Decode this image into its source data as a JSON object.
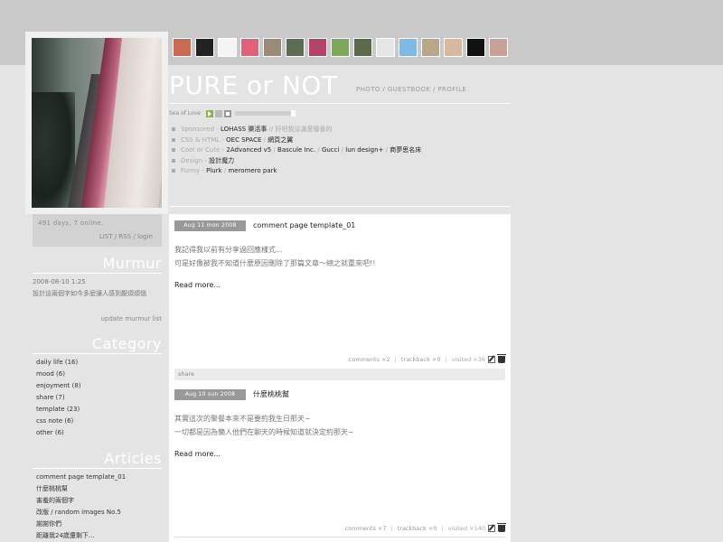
{
  "site": {
    "title": "PURE or NOT",
    "nav": [
      "PHOTO",
      "GUESTBOOK",
      "PROFILE"
    ],
    "stats": "491 days, 7 online.",
    "stat_links": [
      "LIST",
      "RSS",
      "login"
    ]
  },
  "thumbnails": [
    {
      "name": "thumb-1",
      "color": "#c96a55"
    },
    {
      "name": "thumb-2",
      "color": "#222222"
    },
    {
      "name": "thumb-3",
      "color": "#f4f4f4"
    },
    {
      "name": "thumb-4",
      "color": "#e2607a"
    },
    {
      "name": "thumb-5",
      "color": "#9a8a7a"
    },
    {
      "name": "thumb-6",
      "color": "#5e6c53"
    },
    {
      "name": "thumb-7",
      "color": "#b4436a"
    },
    {
      "name": "thumb-8",
      "color": "#7ca85a"
    },
    {
      "name": "thumb-9",
      "color": "#5c6a4a"
    },
    {
      "name": "thumb-10",
      "color": "#e6e6e6"
    },
    {
      "name": "thumb-11",
      "color": "#7fb9e6"
    },
    {
      "name": "thumb-12",
      "color": "#b8a888"
    },
    {
      "name": "thumb-13",
      "color": "#d9b8a0"
    },
    {
      "name": "thumb-14",
      "color": "#111111"
    },
    {
      "name": "thumb-15",
      "color": "#c9a096"
    }
  ],
  "player": {
    "label": "Sea of Love"
  },
  "links": [
    {
      "cat": "Sponsored - ",
      "items": [
        "LOHASS 樂活事"
      ],
      "tail": " // 好吧我這滿愛檀香的"
    },
    {
      "cat": "CSS & HTML - ",
      "items": [
        "OEC SPACE",
        "網頁之翼"
      ],
      "tail": ""
    },
    {
      "cat": "Cool or Cute - ",
      "items": [
        "2Advanced v5",
        "Bascule Inc.",
        "Gucci",
        "lun design+",
        "商夢思名床"
      ],
      "tail": ""
    },
    {
      "cat": "Design - ",
      "items": [
        "設計魔力"
      ],
      "tail": ""
    },
    {
      "cat": "Funny - ",
      "items": [
        "Plurk",
        "meromero park"
      ],
      "tail": ""
    }
  ],
  "murmur": {
    "heading": "Murmur",
    "date": "2008-08-10 1:25",
    "text": "設計這兩個字如今多麼讓人感到厭煩煩惱",
    "update": "update murmur list"
  },
  "category": {
    "heading": "Category",
    "items": [
      "daily life (16)",
      "mood (6)",
      "enjoyment (8)",
      "share (7)",
      "template (23)",
      "css note (6)",
      "other (6)"
    ]
  },
  "articles": {
    "heading": "Articles",
    "items": [
      "comment page template_01",
      "什麼桃桃幫",
      "害羞的兩個字",
      "改版 / random images No.5",
      "謝謝你們",
      "距離我24歲還剩下..."
    ]
  },
  "posts": [
    {
      "date": "Aug 11 mon 2008",
      "title": "comment page template_01",
      "body": [
        "我記得我以前有分享過回應樣式...",
        "可是好像被我不知道什麼原因刪除了那篇文章～總之就重來吧!!"
      ],
      "readmore": "Read more...",
      "comments": "comments ×2",
      "trackback": "trackback ×0",
      "visited": "visited ×36",
      "category": "share"
    },
    {
      "date": "Aug 10 sun 2008",
      "title": "什麼桃桃幫",
      "body": [
        "其實這次的聚餐本來不是要約我生日那天~",
        "一切都是因為懶人他們在聊天的時候知道就決定約那天~"
      ],
      "readmore": "Read more...",
      "comments": "comments ×7",
      "trackback": "trackback ×0",
      "visited": "visited ×140"
    }
  ]
}
